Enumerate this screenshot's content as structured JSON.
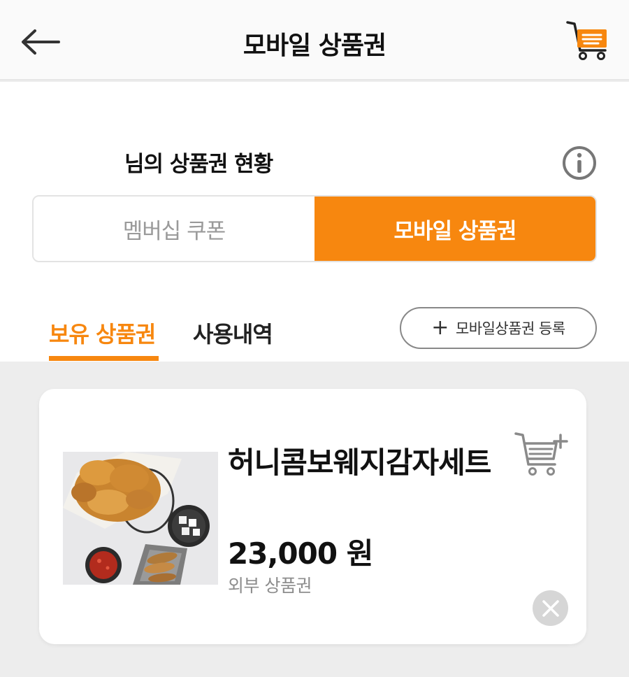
{
  "header": {
    "title": "모바일 상품권",
    "back_icon": "arrow-left-icon",
    "cart_icon": "cart-icon"
  },
  "summary": {
    "status_text": "님의 상품권 현황",
    "info_icon": "info-icon"
  },
  "segment": {
    "items": [
      {
        "label": "멤버십 쿠폰",
        "active": false
      },
      {
        "label": "모바일 상품권",
        "active": true
      }
    ]
  },
  "tabs": [
    {
      "label": "보유 상품권",
      "active": true
    },
    {
      "label": "사용내역",
      "active": false
    }
  ],
  "register_button": {
    "plus": "+",
    "label": "모바일상품권 등록"
  },
  "voucher": {
    "name": "허니콤보웨지감자세트",
    "price": "23,000 원",
    "type": "외부 상품권",
    "image": "fried-chicken-set-photo",
    "add_to_cart_icon": "cart-plus-icon",
    "remove_icon": "close-icon"
  },
  "colors": {
    "accent": "#f7870f",
    "background": "#ededed"
  }
}
